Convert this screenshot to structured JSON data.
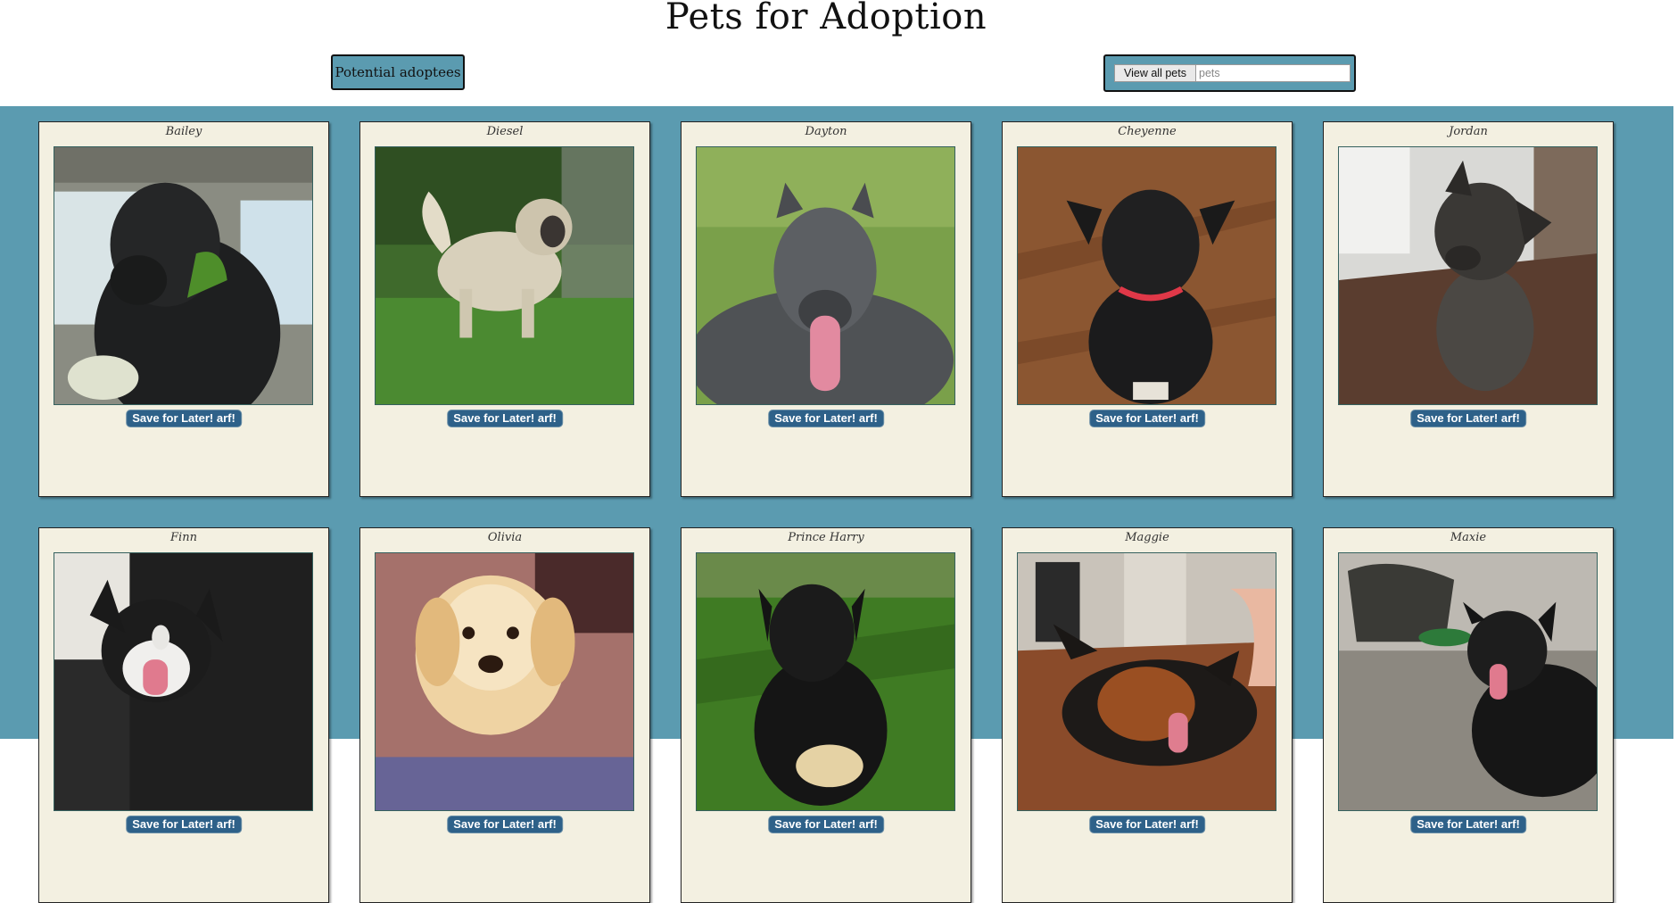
{
  "header": {
    "title": "Pets for Adoption",
    "adoptees_button": "Potential adoptees",
    "view_all_button": "View all pets",
    "search_placeholder": "pets"
  },
  "save_label": "Save for Later! arf!",
  "pets": [
    {
      "name": "Bailey"
    },
    {
      "name": "Diesel"
    },
    {
      "name": "Dayton"
    },
    {
      "name": "Cheyenne"
    },
    {
      "name": "Jordan"
    },
    {
      "name": "Finn"
    },
    {
      "name": "Olivia"
    },
    {
      "name": "Prince Harry"
    },
    {
      "name": "Maggie"
    },
    {
      "name": "Maxie"
    }
  ],
  "colors": {
    "accent": "#5b9bb0",
    "card": "#f3f0e1",
    "save_button": "#2e6189"
  }
}
